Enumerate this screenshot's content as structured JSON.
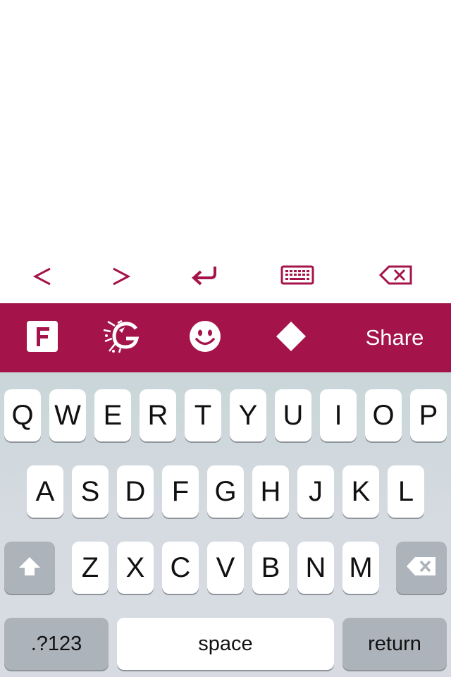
{
  "edit_toolbar": {
    "prev_icon": "chevron-left-icon",
    "next_icon": "chevron-right-icon",
    "return_icon": "return-arrow-icon",
    "keyboard_icon": "keyboard-icon",
    "delete_icon": "delete-backspace-icon"
  },
  "brand_bar": {
    "font_icon": "font-f-icon",
    "graffiti_icon": "graffiti-g-icon",
    "emoji_icon": "smiley-face-icon",
    "shape_icon": "diamond-square-icon",
    "share_label": "Share"
  },
  "keyboard": {
    "row1": [
      "Q",
      "W",
      "E",
      "R",
      "T",
      "Y",
      "U",
      "I",
      "O",
      "P"
    ],
    "row2": [
      "A",
      "S",
      "D",
      "F",
      "G",
      "H",
      "J",
      "K",
      "L"
    ],
    "row3": [
      "Z",
      "X",
      "C",
      "V",
      "B",
      "N",
      "M"
    ],
    "shift_icon": "shift-arrow-icon",
    "backspace_icon": "backspace-icon",
    "numbers_label": ".?123",
    "space_label": "space",
    "return_label": "return"
  },
  "colors": {
    "accent": "#a4144a",
    "keyboard_bg": "#d6dbe1",
    "key_dark": "#acb3bb",
    "key_light": "#ffffff"
  }
}
